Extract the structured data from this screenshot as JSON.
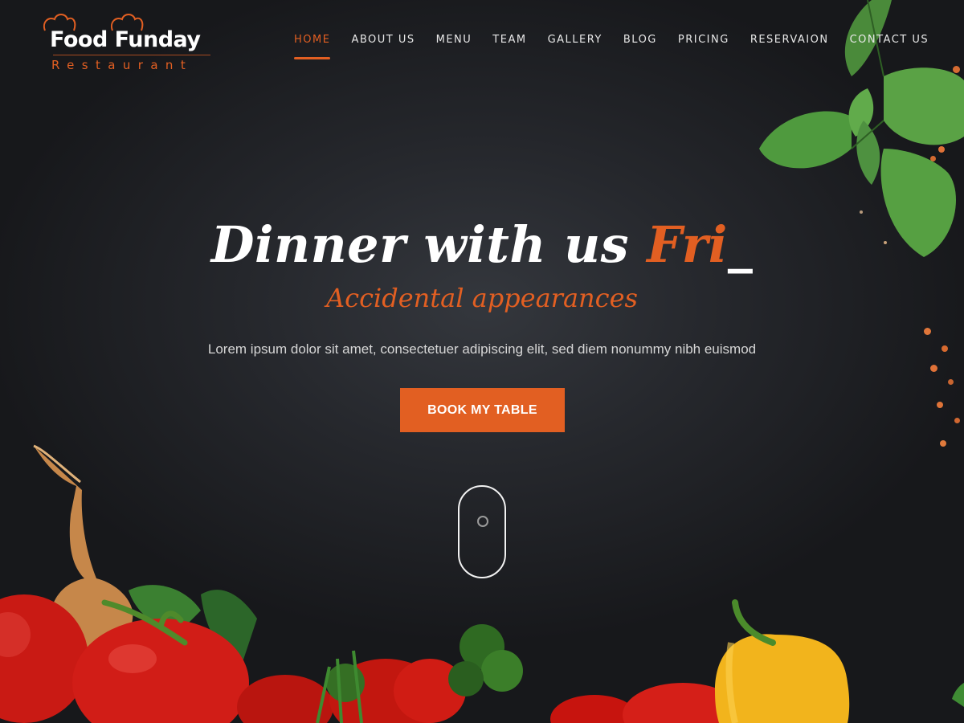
{
  "brand": {
    "name": "Food Funday",
    "tagline": "Restaurant"
  },
  "nav": {
    "items": [
      {
        "label": "HOME",
        "active": true
      },
      {
        "label": "ABOUT US",
        "active": false
      },
      {
        "label": "MENU",
        "active": false
      },
      {
        "label": "TEAM",
        "active": false
      },
      {
        "label": "GALLERY",
        "active": false
      },
      {
        "label": "BLOG",
        "active": false
      },
      {
        "label": "PRICING",
        "active": false
      },
      {
        "label": "RESERVAION",
        "active": false
      },
      {
        "label": "CONTACT US",
        "active": false
      }
    ]
  },
  "hero": {
    "headline_prefix": "Dinner with us ",
    "headline_accent": "Fri",
    "headline_cursor": "_",
    "subheadline": "Accidental appearances",
    "lead": "Lorem ipsum dolor sit amet, consectetuer adipiscing elit, sed diem nonummy nibh euismod",
    "cta_label": "BOOK MY TABLE",
    "scroll_icon": "mouse-scroll-icon"
  },
  "colors": {
    "accent": "#e25f22",
    "background": "#1a1c20",
    "text": "#ffffff"
  }
}
